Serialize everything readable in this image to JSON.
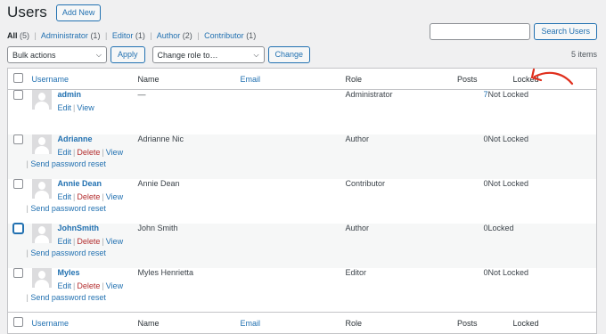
{
  "header": {
    "title": "Users",
    "add_new_label": "Add New"
  },
  "filters": [
    {
      "label": "All",
      "count": "(5)"
    },
    {
      "label": "Administrator",
      "count": "(1)"
    },
    {
      "label": "Editor",
      "count": "(1)"
    },
    {
      "label": "Author",
      "count": "(2)"
    },
    {
      "label": "Contributor",
      "count": "(1)"
    }
  ],
  "search": {
    "button_label": "Search Users",
    "value": ""
  },
  "tablenav": {
    "bulk_actions": "Bulk actions",
    "apply_label": "Apply",
    "change_role": "Change role to…",
    "change_label": "Change",
    "items_count": "5 items"
  },
  "columns": {
    "username": "Username",
    "name": "Name",
    "email": "Email",
    "role": "Role",
    "posts": "Posts",
    "locked": "Locked"
  },
  "row_actions": {
    "edit": "Edit",
    "delete": "Delete",
    "view": "View",
    "send_reset": "Send password reset"
  },
  "rows": [
    {
      "username": "admin",
      "name": "—",
      "email": "",
      "role": "Administrator",
      "posts": "7",
      "locked": "Not Locked"
    },
    {
      "username": "Adrianne",
      "name": "Adrianne Nic",
      "email": "",
      "role": "Author",
      "posts": "0",
      "locked": "Not Locked"
    },
    {
      "username": "Annie Dean",
      "name": "Annie Dean",
      "email": "",
      "role": "Contributor",
      "posts": "0",
      "locked": "Not Locked"
    },
    {
      "username": "JohnSmith",
      "name": "John Smith",
      "email": "",
      "role": "Author",
      "posts": "0",
      "locked": "Locked"
    },
    {
      "username": "Myles",
      "name": "Myles Henrietta",
      "email": "",
      "role": "Editor",
      "posts": "0",
      "locked": "Not Locked"
    }
  ],
  "colors": {
    "link": "#2271b1",
    "delete": "#b32d2e",
    "annotation_arrow": "#e0301e"
  }
}
